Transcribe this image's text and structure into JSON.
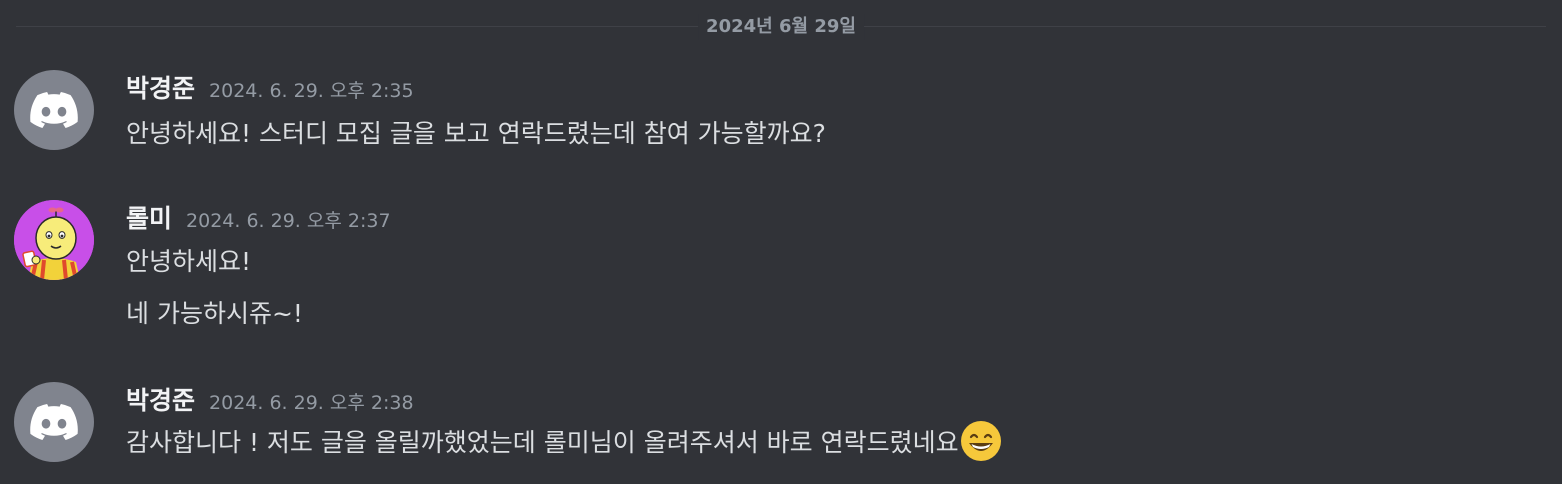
{
  "date_divider": "2024년 6월 29일",
  "messages": [
    {
      "username": "박경준",
      "timestamp": "2024. 6. 29. 오후 2:35",
      "avatar": "discord-default-icon",
      "lines": [
        "안녕하세요! 스터디 모집 글을 보고 연락드렸는데 참여 가능할까요?"
      ]
    },
    {
      "username": "롤미",
      "timestamp": "2024. 6. 29. 오후 2:37",
      "avatar": "custom-character-avatar",
      "lines": [
        "안녕하세요!",
        "네 가능하시쥬~!"
      ]
    },
    {
      "username": "박경준",
      "timestamp": "2024. 6. 29. 오후 2:38",
      "avatar": "discord-default-icon",
      "lines": [
        "감사합니다 ! 저도 글을 올릴까했었는데 롤미님이 올려주셔서 바로 연락드렸네요"
      ],
      "emoji": "grinning-smile-emoji"
    }
  ],
  "colors": {
    "background": "#313338",
    "username": "#f2f3f5",
    "timestamp": "#949ba4",
    "text": "#dbdee1",
    "default_avatar": "#80848e",
    "custom_avatar_bg": "#c84fe8"
  }
}
